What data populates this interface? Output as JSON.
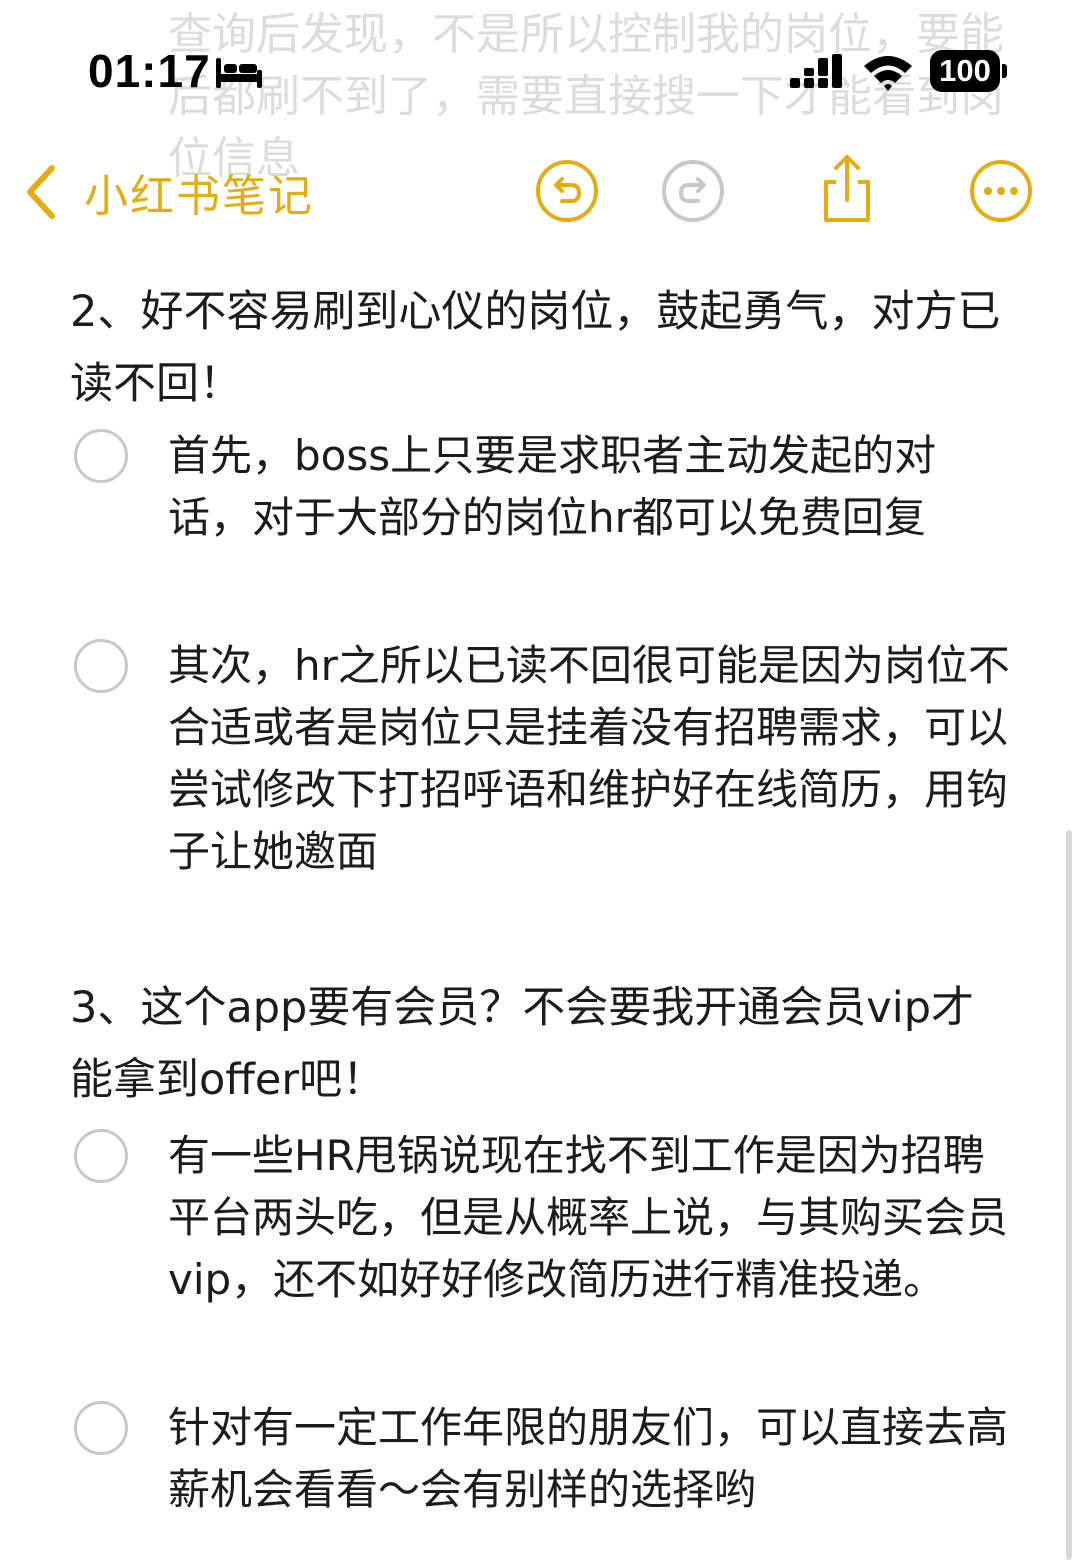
{
  "ghost_text": "查询后发现，不是所以控制我的岗位，要能后都刷不到了，需要直接搜一下才能看到岗位信息",
  "status_bar": {
    "time": "01:17",
    "battery": "100"
  },
  "nav": {
    "back_label": "小红书笔记"
  },
  "colors": {
    "accent": "#e3ac13",
    "checkbox_border": "#c8c8cc",
    "text": "#1c1c1e"
  },
  "sections": [
    {
      "heading": "2、好不容易刷到心仪的岗位，鼓起勇气，对方已读不回！",
      "items": [
        {
          "text": "首先，boss上只要是求职者主动发起的对话，对于大部分的岗位hr都可以免费回复",
          "checked": false
        },
        {
          "text": "其次，hr之所以已读不回很可能是因为岗位不合适或者是岗位只是挂着没有招聘需求，可以尝试修改下打招呼语和维护好在线简历，用钩子让她邀面",
          "checked": false
        }
      ]
    },
    {
      "heading": "3、这个app要有会员？不会要我开通会员vip才能拿到offer吧！",
      "items": [
        {
          "text": "有一些HR甩锅说现在找不到工作是因为招聘平台两头吃，但是从概率上说，与其购买会员vip，还不如好好修改简历进行精准投递。",
          "checked": false
        },
        {
          "text": "针对有一定工作年限的朋友们，可以直接去高薪机会看看～会有别样的选择哟",
          "checked": false
        }
      ]
    }
  ]
}
